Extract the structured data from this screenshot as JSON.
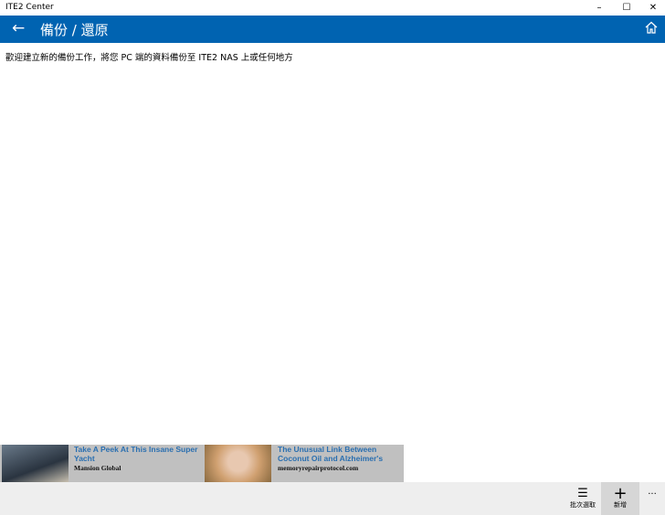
{
  "window": {
    "title": "ITE2 Center",
    "minimize": "–",
    "maximize": "☐",
    "close": "✕"
  },
  "header": {
    "back": "←",
    "title": "備份 / 還原"
  },
  "main": {
    "welcome": "歡迎建立新的備份工作，將您 PC 端的資料備份至 ITE2 NAS 上或任何地方"
  },
  "ads": [
    {
      "headline": "Take A Peek At This Insane Super Yacht",
      "source": "Mansion Global"
    },
    {
      "headline": "The Unusual Link Between Coconut Oil and Alzheimer's",
      "source": "memoryrepairprotocol.com"
    }
  ],
  "appbar": {
    "batch_label": "批次選取",
    "batch_icon": "☰",
    "add_label": "新增",
    "add_icon": "+",
    "more": "···"
  }
}
